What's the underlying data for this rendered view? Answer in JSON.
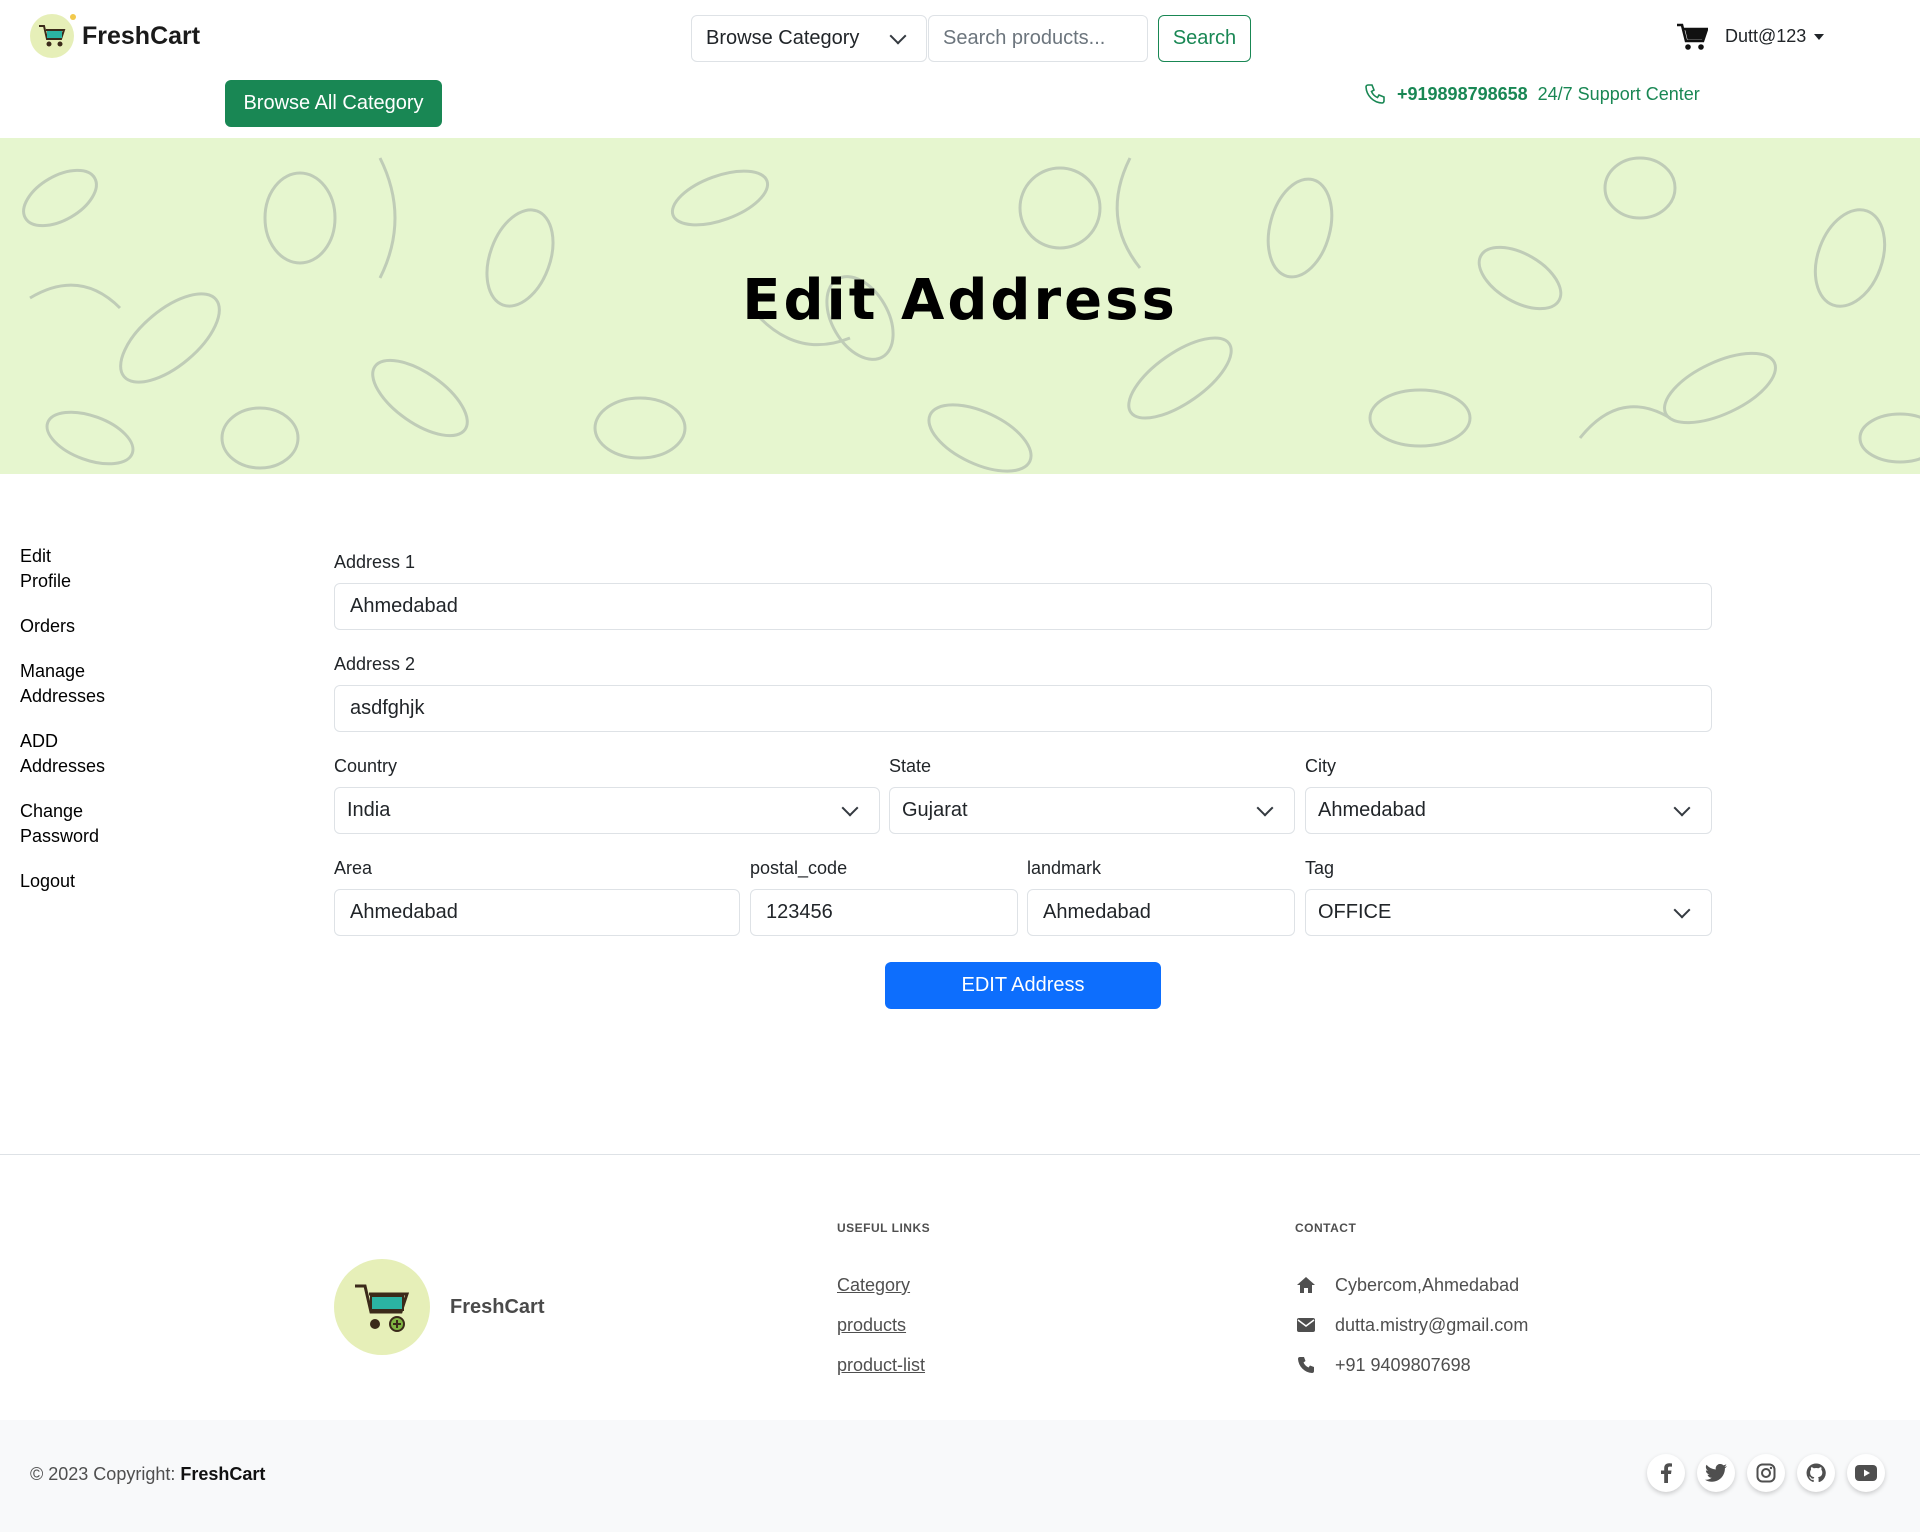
{
  "brand": {
    "name": "FreshCart",
    "accent": "#198754",
    "primary": "#0d6efd"
  },
  "header": {
    "category_select": "Browse Category",
    "search_placeholder": "Search products...",
    "search_button": "Search",
    "user_name": "Dutt@123",
    "browse_all_button": "Browse All Category",
    "support_phone": "+919898798658",
    "support_text": "24/7 Support Center"
  },
  "hero": {
    "title": "Edit Address"
  },
  "sidebar": {
    "items": [
      {
        "label": "Edit Profile"
      },
      {
        "label": "Orders"
      },
      {
        "label": "Manage Addresses"
      },
      {
        "label": "ADD Addresses"
      },
      {
        "label": "Change Password"
      },
      {
        "label": "Logout"
      }
    ]
  },
  "form": {
    "address1": {
      "label": "Address 1",
      "value": "Ahmedabad"
    },
    "address2": {
      "label": "Address 2",
      "value": "asdfghjk"
    },
    "country": {
      "label": "Country",
      "value": "India"
    },
    "state": {
      "label": "State",
      "value": "Gujarat"
    },
    "city": {
      "label": "City",
      "value": "Ahmedabad"
    },
    "area": {
      "label": "Area",
      "value": "Ahmedabad"
    },
    "postal_code": {
      "label": "postal_code",
      "value": "123456"
    },
    "landmark": {
      "label": "landmark",
      "value": "Ahmedabad"
    },
    "tag": {
      "label": "Tag",
      "value": "OFFICE"
    },
    "submit": "EDIT Address"
  },
  "footer": {
    "brand": "FreshCart",
    "useful_links_title": "USEFUL LINKS",
    "links": [
      "Category",
      "products",
      "product-list"
    ],
    "contact_title": "CONTACT",
    "contact": {
      "address": "Cybercom,Ahmedabad",
      "email": "dutta.mistry@gmail.com",
      "phone": "+91 9409807698"
    },
    "copyright_prefix": "© 2023 Copyright:",
    "copyright_brand": "FreshCart",
    "socials": [
      "facebook-icon",
      "twitter-icon",
      "instagram-icon",
      "github-icon",
      "youtube-icon"
    ]
  }
}
